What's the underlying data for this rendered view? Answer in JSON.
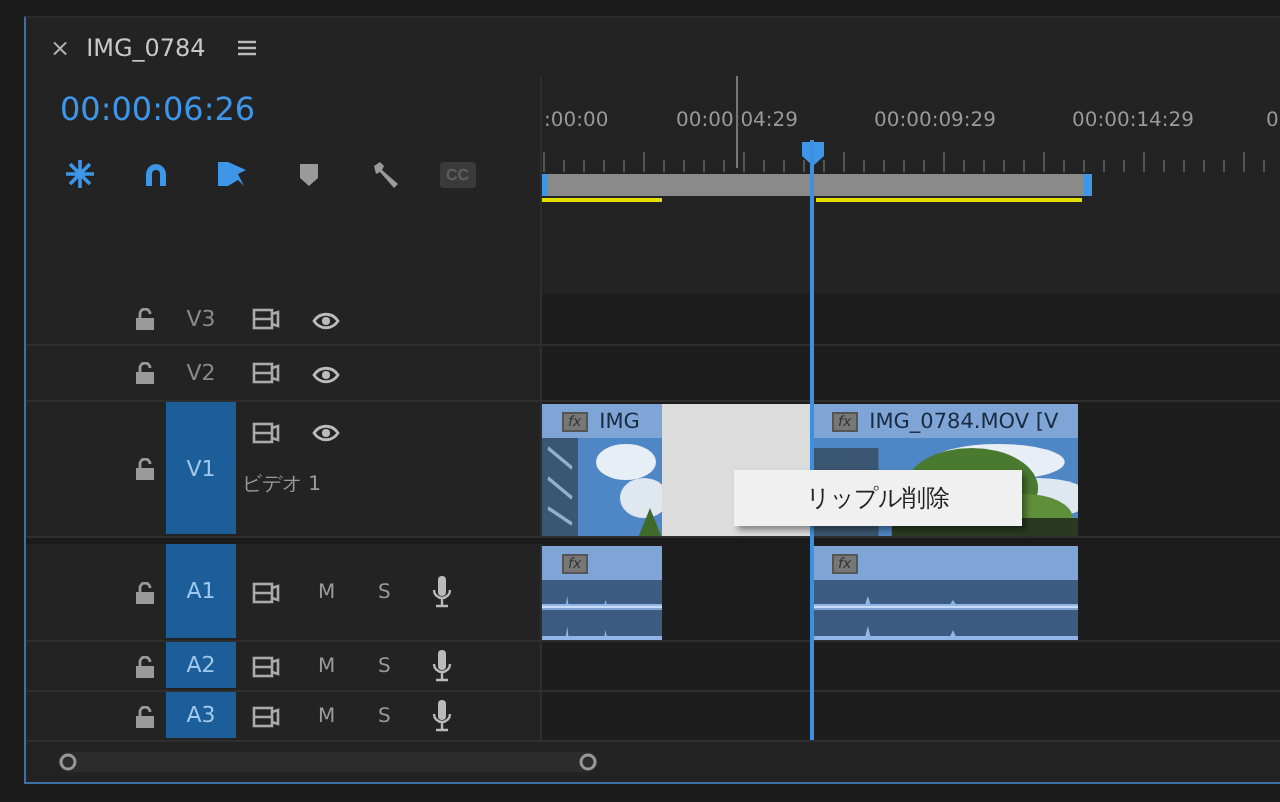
{
  "panel": {
    "close": "×",
    "title": "IMG_0784"
  },
  "timecode": "00:00:06:26",
  "tools": [
    {
      "kind": "snap",
      "on": true
    },
    {
      "kind": "link",
      "on": true
    },
    {
      "kind": "select",
      "on": true
    },
    {
      "kind": "marker",
      "on": false
    },
    {
      "kind": "wrench",
      "on": false
    },
    {
      "kind": "captions",
      "on": false,
      "label": "CC"
    }
  ],
  "ruler": {
    "labels": [
      ":00:00",
      "00:00:04:29",
      "00:00:09:29",
      "00:00:14:29",
      "0"
    ]
  },
  "tracks": [
    {
      "kind": "video",
      "label": "V3",
      "targeted": false
    },
    {
      "kind": "video",
      "label": "V2",
      "targeted": false
    },
    {
      "kind": "video",
      "label": "V1",
      "targeted": true,
      "name": "ビデオ 1",
      "clips": [
        {
          "kind": "clip",
          "label": "IMG",
          "badge": "fx"
        },
        {
          "kind": "gap",
          "selected": true
        },
        {
          "kind": "clip",
          "label": "IMG_0784.MOV [V",
          "badge": "fx"
        }
      ]
    },
    {
      "kind": "audio",
      "label": "A1",
      "targeted": true,
      "mute": "M",
      "solo": "S",
      "clips": [
        {
          "kind": "clip",
          "badge": "fx"
        },
        {
          "kind": "empty"
        },
        {
          "kind": "clip",
          "badge": "fx"
        }
      ]
    },
    {
      "kind": "audio",
      "label": "A2",
      "targeted": true,
      "mute": "M",
      "solo": "S"
    },
    {
      "kind": "audio",
      "label": "A3",
      "targeted": true,
      "mute": "M",
      "solo": "S"
    }
  ],
  "context_menu": {
    "items": [
      "リップル削除"
    ]
  }
}
